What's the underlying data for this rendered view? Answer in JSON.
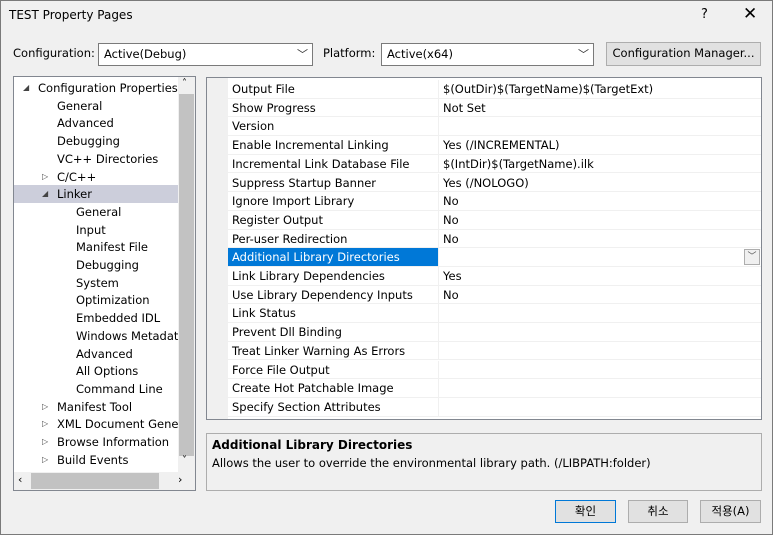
{
  "window": {
    "title": "TEST Property Pages",
    "help": "?",
    "close": "✕"
  },
  "config": {
    "label": "Configuration:",
    "value": "Active(Debug)",
    "platform_label": "Platform:",
    "platform_value": "Active(x64)",
    "manager_button": "Configuration Manager..."
  },
  "tree": [
    {
      "label": "Configuration Properties",
      "level": 0,
      "exp": "open"
    },
    {
      "label": "General",
      "level": 1
    },
    {
      "label": "Advanced",
      "level": 1
    },
    {
      "label": "Debugging",
      "level": 1
    },
    {
      "label": "VC++ Directories",
      "level": 1
    },
    {
      "label": "C/C++",
      "level": 1,
      "exp": "closed"
    },
    {
      "label": "Linker",
      "level": 1,
      "exp": "open",
      "selected": true
    },
    {
      "label": "General",
      "level": 2
    },
    {
      "label": "Input",
      "level": 2
    },
    {
      "label": "Manifest File",
      "level": 2
    },
    {
      "label": "Debugging",
      "level": 2
    },
    {
      "label": "System",
      "level": 2
    },
    {
      "label": "Optimization",
      "level": 2
    },
    {
      "label": "Embedded IDL",
      "level": 2
    },
    {
      "label": "Windows Metadata",
      "level": 2
    },
    {
      "label": "Advanced",
      "level": 2
    },
    {
      "label": "All Options",
      "level": 2
    },
    {
      "label": "Command Line",
      "level": 2
    },
    {
      "label": "Manifest Tool",
      "level": 1,
      "exp": "closed"
    },
    {
      "label": "XML Document Generator",
      "level": 1,
      "exp": "closed"
    },
    {
      "label": "Browse Information",
      "level": 1,
      "exp": "closed"
    },
    {
      "label": "Build Events",
      "level": 1,
      "exp": "closed"
    }
  ],
  "properties": [
    {
      "name": "Output File",
      "value": "$(OutDir)$(TargetName)$(TargetExt)"
    },
    {
      "name": "Show Progress",
      "value": "Not Set"
    },
    {
      "name": "Version",
      "value": ""
    },
    {
      "name": "Enable Incremental Linking",
      "value": "Yes (/INCREMENTAL)"
    },
    {
      "name": "Incremental Link Database File",
      "value": "$(IntDir)$(TargetName).ilk"
    },
    {
      "name": "Suppress Startup Banner",
      "value": "Yes (/NOLOGO)"
    },
    {
      "name": "Ignore Import Library",
      "value": "No"
    },
    {
      "name": "Register Output",
      "value": "No"
    },
    {
      "name": "Per-user Redirection",
      "value": "No"
    },
    {
      "name": "Additional Library Directories",
      "value": "",
      "selected": true
    },
    {
      "name": "Link Library Dependencies",
      "value": "Yes"
    },
    {
      "name": "Use Library Dependency Inputs",
      "value": "No"
    },
    {
      "name": "Link Status",
      "value": ""
    },
    {
      "name": "Prevent Dll Binding",
      "value": ""
    },
    {
      "name": "Treat Linker Warning As Errors",
      "value": ""
    },
    {
      "name": "Force File Output",
      "value": ""
    },
    {
      "name": "Create Hot Patchable Image",
      "value": ""
    },
    {
      "name": "Specify Section Attributes",
      "value": ""
    }
  ],
  "description": {
    "title": "Additional Library Directories",
    "text": "Allows the user to override the environmental library path. (/LIBPATH:folder)"
  },
  "buttons": {
    "ok": "확인",
    "cancel": "취소",
    "apply": "적용(A)"
  },
  "colors": {
    "selection": "#0078d7",
    "tree_selection": "#cccedb"
  }
}
